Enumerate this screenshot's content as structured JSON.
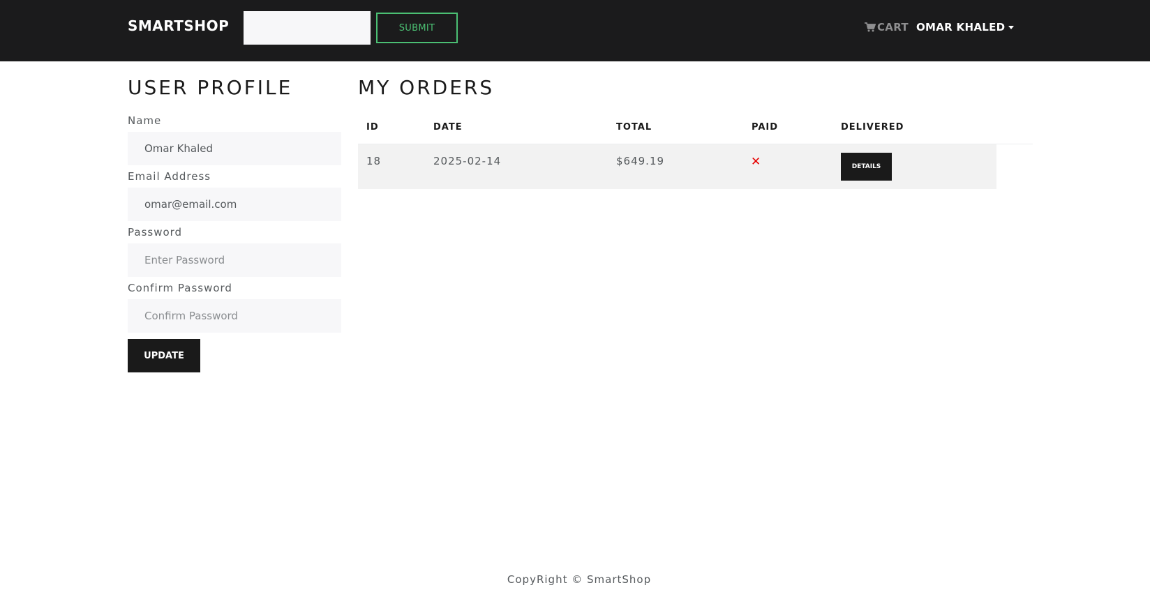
{
  "navbar": {
    "brand": "SMARTSHOP",
    "search_value": "",
    "submit_label": "SUBMIT",
    "cart_label": "CART",
    "user_name": "OMAR KHALED"
  },
  "profile": {
    "title": "USER PROFILE",
    "name_label": "Name",
    "name_value": "Omar Khaled",
    "email_label": "Email Address",
    "email_value": "omar@email.com",
    "password_label": "Password",
    "password_placeholder": "Enter Password",
    "confirm_label": "Confirm Password",
    "confirm_placeholder": "Confirm Password",
    "update_label": "UPDATE"
  },
  "orders": {
    "title": "MY ORDERS",
    "columns": [
      "ID",
      "DATE",
      "TOTAL",
      "PAID",
      "DELIVERED"
    ],
    "rows": [
      {
        "id": "18",
        "date": "2025-02-14",
        "total": "$649.19",
        "paid": "✕",
        "details_label": "DETAILS"
      }
    ]
  },
  "footer": {
    "text": "CopyRight © SmartShop"
  },
  "colors": {
    "navbar_bg": "#1b1b1c",
    "accent_green": "#4bbf73",
    "unpaid_red": "#e60000",
    "dark_button": "#1a1a1a"
  },
  "icons": {
    "cart": "cart-icon",
    "unpaid": "x-icon",
    "dropdown": "caret-down-icon"
  }
}
